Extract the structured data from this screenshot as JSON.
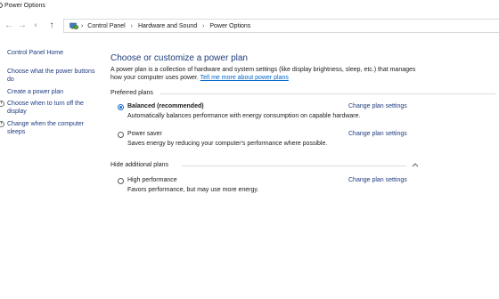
{
  "window": {
    "title": "Power Options"
  },
  "nav": {
    "back_icon": "arrow-left-icon",
    "forward_icon": "arrow-right-icon",
    "recent_icon": "chevron-down-icon",
    "up_icon": "arrow-up-icon"
  },
  "breadcrumb": {
    "items": [
      "Control Panel",
      "Hardware and Sound",
      "Power Options"
    ],
    "separator": "›"
  },
  "sidebar": {
    "home": "Control Panel Home",
    "links": [
      {
        "label": "Choose what the power buttons do",
        "icon": ""
      },
      {
        "label": "Create a power plan",
        "icon": ""
      },
      {
        "label": "Choose when to turn off the display",
        "icon": "power-icon"
      },
      {
        "label": "Change when the computer sleeps",
        "icon": "power-icon"
      }
    ]
  },
  "main": {
    "title": "Choose or customize a power plan",
    "description": "A power plan is a collection of hardware and system settings (like display brightness, sleep, etc.) that manages how your computer uses power.",
    "learn_more": "Tell me more about power plans",
    "preferred_label": "Preferred plans",
    "hide_label": "Hide additional plans",
    "plans": [
      {
        "name": "Balanced (recommended)",
        "desc": "Automatically balances performance with energy consumption on capable hardware.",
        "selected": true,
        "change": "Change plan settings"
      },
      {
        "name": "Power saver",
        "desc": "Saves energy by reducing your computer's performance where possible.",
        "selected": false,
        "change": "Change plan settings"
      },
      {
        "name": "High performance",
        "desc": "Favors performance, but may use more energy.",
        "selected": false,
        "change": "Change plan settings"
      }
    ]
  },
  "colors": {
    "link": "#1e3b80",
    "accent": "#1a6fc9",
    "title": "#1f3d7a"
  }
}
